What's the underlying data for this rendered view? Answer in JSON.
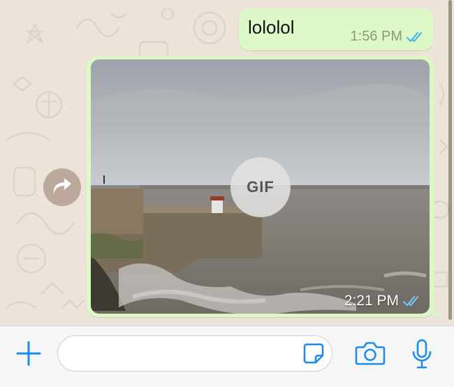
{
  "colors": {
    "outgoing_bubble": "#dcf8c6",
    "accent": "#1a8cf0",
    "read_ticks": "#4fb6ec",
    "wallpaper": "#ece4d9",
    "forward_button": "#bda99b"
  },
  "messages": [
    {
      "type": "text",
      "direction": "outgoing",
      "text": "lololol",
      "time": "1:56 PM",
      "status_icon": "double-check-read-icon"
    },
    {
      "type": "gif",
      "direction": "outgoing",
      "badge": "GIF",
      "time": "2:21 PM",
      "status_icon": "double-check-read-icon"
    }
  ],
  "forward_icon": "forward-arrow-icon",
  "composer": {
    "placeholder": "",
    "value": "",
    "icons": [
      "plus-icon",
      "sticker-icon",
      "camera-icon",
      "microphone-icon"
    ]
  }
}
